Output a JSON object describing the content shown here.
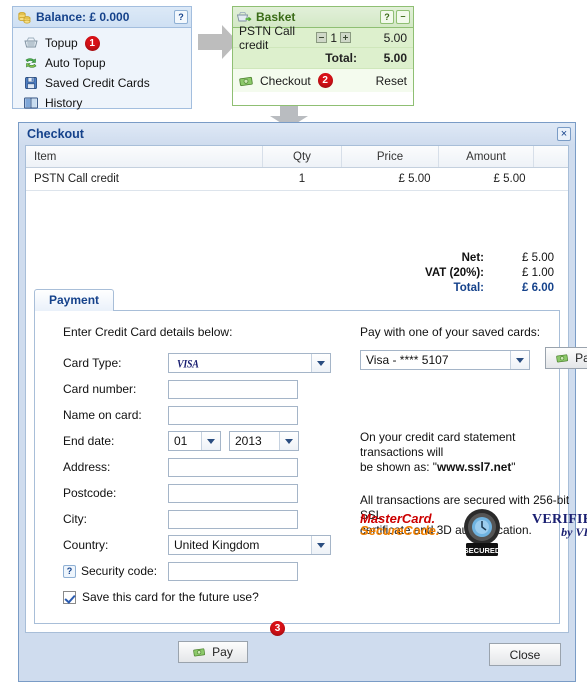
{
  "balance_panel": {
    "title": "Balance: £ 0.000",
    "help_label": "?",
    "items": [
      {
        "label": "Topup",
        "icon": "topup-cart-icon",
        "badge": "1"
      },
      {
        "label": "Auto Topup",
        "icon": "auto-topup-refresh-icon",
        "badge": ""
      },
      {
        "label": "Saved Credit Cards",
        "icon": "save-disk-icon",
        "badge": ""
      },
      {
        "label": "History",
        "icon": "history-book-icon",
        "badge": ""
      }
    ]
  },
  "basket_panel": {
    "title": "Basket",
    "help_label": "?",
    "minimize_label": "–",
    "row": {
      "name": "PSTN Call credit",
      "qty": "1",
      "amount": "5.00"
    },
    "total_label": "Total:",
    "total_value": "5.00",
    "checkout_label": "Checkout",
    "checkout_badge": "2",
    "reset_label": "Reset"
  },
  "checkout": {
    "title": "Checkout",
    "close_label": "×",
    "table": {
      "headers": [
        "Item",
        "Qty",
        "Price",
        "Amount"
      ],
      "rows": [
        {
          "item": "PSTN Call credit",
          "qty": "1",
          "price": "£ 5.00",
          "amount": "£ 5.00"
        }
      ]
    },
    "totals": [
      {
        "label": "Net:",
        "value": "£ 5.00"
      },
      {
        "label": "VAT (20%):",
        "value": "£ 1.00"
      },
      {
        "label": "Total:",
        "value": "£ 6.00"
      }
    ],
    "tab_label": "Payment",
    "form": {
      "section_title": "Enter Credit Card details below:",
      "card_type_label": "Card Type:",
      "card_type_value": "VISA",
      "card_number_label": "Card number:",
      "card_number_value": "",
      "name_on_card_label": "Name on card:",
      "name_on_card_value": "",
      "end_date_label": "End date:",
      "end_month_value": "01",
      "end_year_value": "2013",
      "address_label": "Address:",
      "address_value": "",
      "postcode_label": "Postcode:",
      "postcode_value": "",
      "city_label": "City:",
      "city_value": "",
      "country_label": "Country:",
      "country_value": "United Kingdom",
      "security_code_label": "Security code:",
      "security_code_value": "",
      "security_help_label": "?",
      "save_card_label": "Save this card for the future use?",
      "pay_label": "Pay",
      "pay_badge": "3"
    },
    "saved": {
      "heading": "Pay with one of your saved cards:",
      "card_value": "Visa - **** 5107",
      "pay_label": "Pay",
      "statement_line1": "On your credit card statement transactions will",
      "statement_line2_prefix": "be shown as: \"",
      "statement_site": "www.ssl7.net",
      "statement_line2_suffix": "\"",
      "security_line1": "All transactions are secured with 256-bit SSL",
      "security_line2": "certificate and 3D authentication."
    },
    "badges": {
      "mastercard_line1": "MasterCard.",
      "mastercard_line2": "SecureCode.",
      "seal_label": "SECURED",
      "visa_line1": "VERIFIED",
      "visa_line2": "by VISA"
    },
    "close_button_label": "Close"
  },
  "colors": {
    "accent_blue": "#15428b",
    "basket_green": "#3a6b17",
    "badge_red": "#d81117",
    "arrow_gray": "#bdbdbd"
  }
}
